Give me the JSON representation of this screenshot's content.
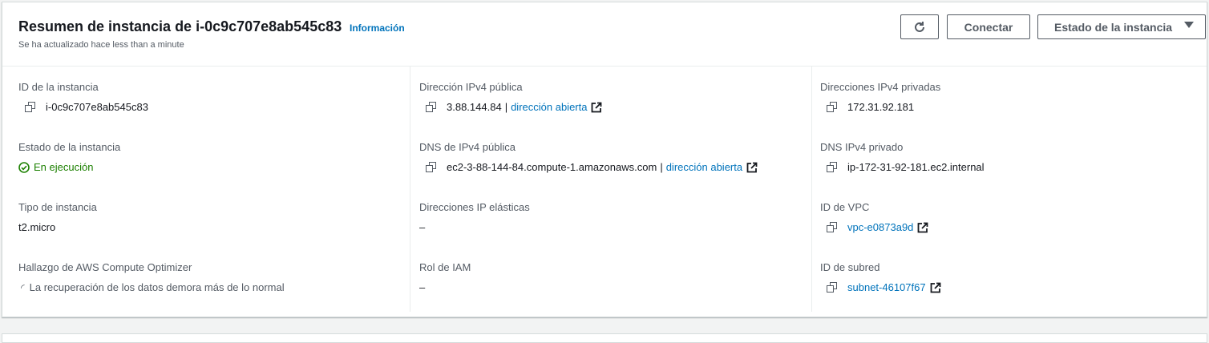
{
  "header": {
    "title": "Resumen de instancia de i-0c9c707e8ab545c83",
    "info_link": "Información",
    "subtitle": "Se ha actualizado hace less than a minute",
    "buttons": {
      "connect": "Conectar",
      "instance_state": "Estado de la instancia"
    }
  },
  "fields": {
    "instance_id": {
      "label": "ID de la instancia",
      "value": "i-0c9c707e8ab545c83"
    },
    "public_ipv4": {
      "label": "Dirección IPv4 pública",
      "value": "3.88.144.84",
      "link": "dirección abierta"
    },
    "private_ipv4": {
      "label": "Direcciones IPv4 privadas",
      "value": "172.31.92.181"
    },
    "instance_state": {
      "label": "Estado de la instancia",
      "value": "En ejecución"
    },
    "public_dns": {
      "label": "DNS de IPv4 pública",
      "value": "ec2-3-88-144-84.compute-1.amazonaws.com",
      "link": "dirección abierta"
    },
    "private_dns": {
      "label": "DNS IPv4 privado",
      "value": "ip-172-31-92-181.ec2.internal"
    },
    "instance_type": {
      "label": "Tipo de instancia",
      "value": "t2.micro"
    },
    "elastic_ips": {
      "label": "Direcciones IP elásticas",
      "value": "–"
    },
    "vpc_id": {
      "label": "ID de VPC",
      "value": "vpc-e0873a9d"
    },
    "compute_optimizer": {
      "label": "Hallazgo de AWS Compute Optimizer",
      "value": "La recuperación de los datos demora más de lo normal"
    },
    "iam_role": {
      "label": "Rol de IAM",
      "value": "–"
    },
    "subnet_id": {
      "label": "ID de subred",
      "value": "subnet-46107f67"
    }
  },
  "colors": {
    "link": "#0073bb",
    "success": "#1d8102",
    "label": "#545b64"
  },
  "icons": [
    "refresh-icon",
    "caret-down-icon",
    "copy-icon",
    "external-link-icon",
    "status-check-icon",
    "spinner-icon"
  ]
}
